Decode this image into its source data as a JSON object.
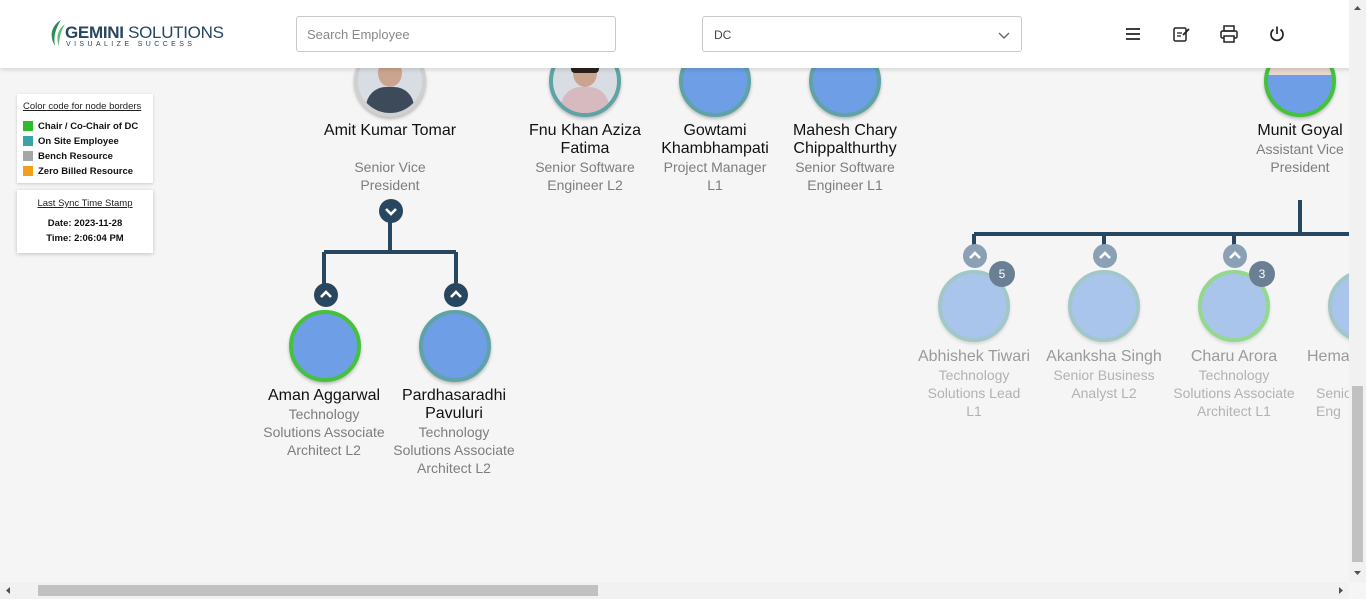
{
  "header": {
    "logo_main_bold": "GEMINI",
    "logo_main_rest": " SOLUTIONS",
    "logo_tagline": "VISUALIZE SUCCESS",
    "search_placeholder": "Search Employee",
    "select_value": "DC",
    "icons": [
      "menu-icon",
      "edit-note-icon",
      "print-icon",
      "power-icon"
    ]
  },
  "legend": {
    "title": "Color code for node borders",
    "items": [
      {
        "label": "Chair / Co-Chair of DC",
        "color": "#2fba2b"
      },
      {
        "label": "On Site Employee",
        "color": "#3aa3a5"
      },
      {
        "label": "Bench Resource",
        "color": "#a6a6a6"
      },
      {
        "label": "Zero Billed Resource",
        "color": "#f2a01a"
      }
    ]
  },
  "sync": {
    "title": "Last Sync Time Stamp",
    "date": "Date: 2023-11-28",
    "time": "Time: 2:06:04 PM"
  },
  "nodes": {
    "amit": {
      "name": "Amit Kumar Tomar",
      "title": "Senior Vice President"
    },
    "fnu": {
      "name": "Fnu Khan Aziza Fatima",
      "title": "Senior Software Engineer L2"
    },
    "gowtami": {
      "name": "Gowtami Khambhampati",
      "title": "Project Manager L1"
    },
    "mahesh": {
      "name": "Mahesh Chary Chippalthurthy",
      "title": "Senior Software Engineer L1"
    },
    "munit": {
      "name": "Munit Goyal",
      "title": "Assistant Vice President"
    },
    "aman": {
      "name": "Aman Aggarwal",
      "title": "Technology Solutions Associate Architect L2"
    },
    "pardha": {
      "name": "Pardhasaradhi Pavuluri",
      "title": "Technology Solutions Associate Architect L2"
    },
    "abhishek": {
      "name": "Abhishek Tiwari",
      "title": "Technology Solutions Lead L1",
      "badge": "5"
    },
    "akanksha": {
      "name": "Akanksha Singh",
      "title": "Senior Business Analyst L2"
    },
    "charu": {
      "name": "Charu Arora",
      "title": "Technology Solutions Associate Architect L1",
      "badge": "3"
    },
    "hema": {
      "name": "Hema",
      "title": "Senio Eng"
    }
  },
  "colors": {
    "chair_border": "#45c23d",
    "onsite_border": "#5fa3a6",
    "node_fill": "#6e9fe6",
    "connector": "#27465f"
  }
}
